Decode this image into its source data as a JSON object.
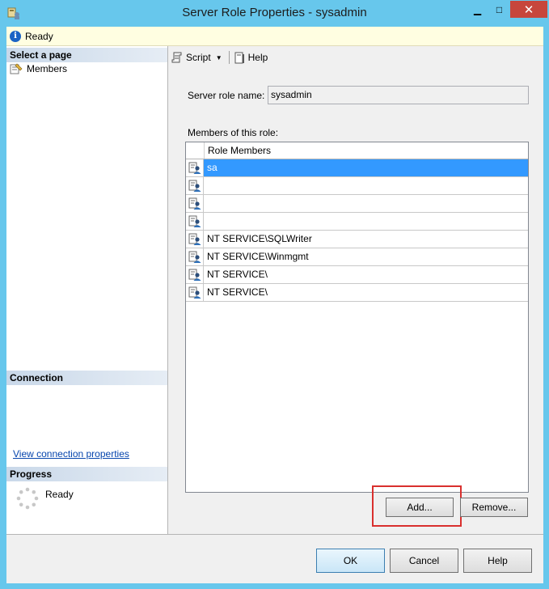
{
  "window": {
    "title": "Server Role Properties - sysadmin",
    "minimize_symbol": "▁",
    "maximize_symbol": "□",
    "close_symbol": "✕"
  },
  "status": {
    "text": "Ready",
    "icon": "info-icon"
  },
  "left_panel": {
    "select_page_header": "Select a page",
    "pages": [
      {
        "label": "Members",
        "icon": "page-icon"
      }
    ],
    "connection_header": "Connection",
    "connection_link": "View connection properties",
    "progress_header": "Progress",
    "progress_status": "Ready"
  },
  "toolbar": {
    "script_label": "Script",
    "help_label": "Help"
  },
  "form": {
    "role_name_label": "Server role name:",
    "role_name_value": "sysadmin",
    "members_label": "Members of this role:"
  },
  "grid": {
    "column_header": "Role Members",
    "rows": [
      {
        "name": "sa",
        "selected": true
      },
      {
        "name": "",
        "selected": false
      },
      {
        "name": "",
        "selected": false
      },
      {
        "name": "",
        "selected": false
      },
      {
        "name": "NT SERVICE\\SQLWriter",
        "selected": false
      },
      {
        "name": "NT SERVICE\\Winmgmt",
        "selected": false
      },
      {
        "name": "NT SERVICE\\",
        "selected": false
      },
      {
        "name": "NT SERVICE\\",
        "selected": false
      }
    ]
  },
  "buttons": {
    "add": "Add...",
    "remove": "Remove...",
    "ok": "OK",
    "cancel": "Cancel",
    "help": "Help"
  },
  "colors": {
    "title_bar": "#67c7ec",
    "selection": "#3399ff",
    "highlight_box": "#d9302e",
    "close_button": "#c7463c"
  }
}
